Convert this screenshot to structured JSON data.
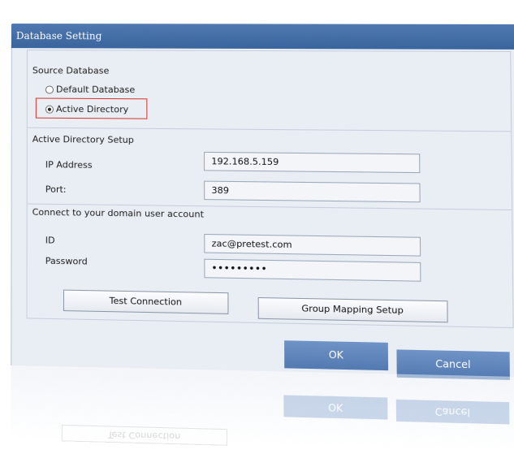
{
  "window": {
    "title": "Database Setting",
    "close_glyph": "✕"
  },
  "source_database": {
    "heading": "Source Database",
    "options": [
      {
        "label": "Default Database",
        "selected": false
      },
      {
        "label": "Active Directory",
        "selected": true
      }
    ]
  },
  "ad_setup": {
    "heading": "Active Directory Setup",
    "ip_label": "IP Address",
    "ip_value": "192.168.5.159",
    "port_label": "Port:",
    "port_value": "389"
  },
  "account": {
    "heading": "Connect to your domain user account",
    "id_label": "ID",
    "id_value": "zac@pretest.com",
    "password_label": "Password",
    "password_value": "•••••••••"
  },
  "buttons": {
    "test_connection": "Test Connection",
    "group_mapping": "Group Mapping Setup",
    "ok": "OK",
    "cancel": "Cancel"
  },
  "colors": {
    "titlebar": "#3f6aa3",
    "primary_button": "#5e84bb",
    "highlight_border": "#d4332a",
    "panel_bg": "#e9eef5"
  },
  "icons": {
    "close": "close-icon"
  }
}
